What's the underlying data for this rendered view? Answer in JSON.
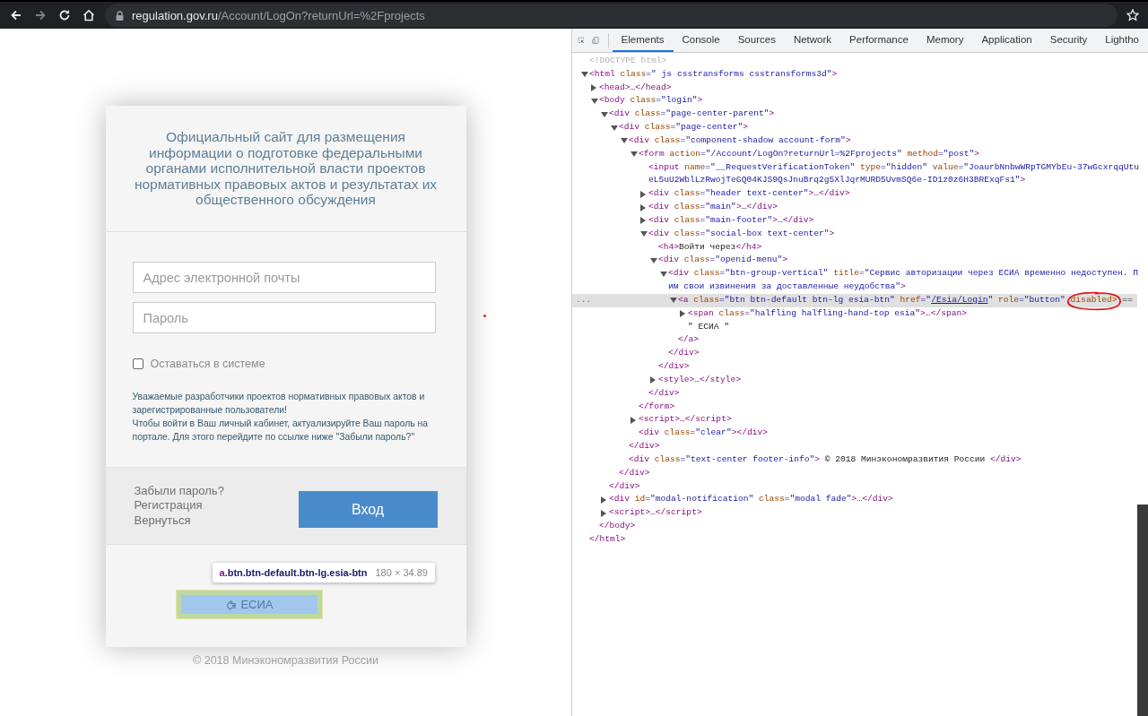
{
  "browser": {
    "nav": [
      {
        "kind": "back",
        "disabled": false
      },
      {
        "kind": "forward",
        "disabled": true
      },
      {
        "kind": "reload",
        "disabled": false
      },
      {
        "kind": "home",
        "disabled": false
      }
    ],
    "address": {
      "host": "regulation.gov.ru",
      "path": "/Account/LogOn?returnUrl=%2Fprojects"
    }
  },
  "login": {
    "title": "Официальный сайт для размещения информации о подготовке федеральными органами исполнительной власти проектов нормативных правовых актов и результатах их общественного обсуждения",
    "email": {
      "placeholder": "Адрес электронной почты"
    },
    "password": {
      "placeholder": "Пароль"
    },
    "remember": {
      "label": "Оставаться в системе",
      "checked": false
    },
    "notice": [
      "Уважаемые разработчики проектов нормативных правовых актов и зарегистрированные пользователи!",
      "Чтобы войти в Ваш личный кабинет, актуализируйте Ваш пароль на портале. Для этого перейдите по ссылке ниже \"Забыли пароль?\""
    ],
    "links": [
      "Забыли пароль?",
      "Регистрация",
      "Вернуться"
    ],
    "submit": "Вход",
    "esia": {
      "label": "ЕСИА",
      "disabled": true,
      "highlighted": true
    },
    "tooltip": {
      "tag": "a",
      "selector": ".btn.btn-default.btn-lg.esia-btn",
      "size": "180 × 34.89"
    }
  },
  "footer": "© 2018 Минэкономразвития России",
  "devtools": {
    "tabs": [
      {
        "label": "Elements",
        "selected": true
      },
      {
        "label": "Console",
        "selected": false
      },
      {
        "label": "Sources",
        "selected": false
      },
      {
        "label": "Network",
        "selected": false
      },
      {
        "label": "Performance",
        "selected": false
      },
      {
        "label": "Memory",
        "selected": false
      },
      {
        "label": "Application",
        "selected": false
      },
      {
        "label": "Security",
        "selected": false
      },
      {
        "label": "Lightho",
        "selected": false
      }
    ],
    "dom": [
      {
        "kind": "leaf",
        "selected": false,
        "lines": [
          [
            {
              "kind": "doc",
              "text": "<!DOCTYPE html>"
            }
          ]
        ]
      },
      {
        "kind": "node",
        "expanded": true,
        "selected": false,
        "lines": [
          [
            {
              "kind": "tag",
              "text": "<html"
            },
            {
              "kind": "attr",
              "text": " class"
            },
            {
              "kind": "val",
              "text": "=\" js csstransforms csstransforms3d\""
            },
            {
              "kind": "tag",
              "text": ">"
            }
          ]
        ],
        "close": [
          {
            "kind": "tag",
            "text": "</html>"
          }
        ],
        "children": [
          {
            "kind": "node",
            "expanded": false,
            "selected": false,
            "lines": [
              [
                {
                  "kind": "tag",
                  "text": "<head>"
                },
                {
                  "kind": "plain",
                  "text": "…"
                },
                {
                  "kind": "tag",
                  "text": "</head>"
                }
              ]
            ]
          },
          {
            "kind": "node",
            "expanded": true,
            "selected": false,
            "lines": [
              [
                {
                  "kind": "tag",
                  "text": "<body"
                },
                {
                  "kind": "attr",
                  "text": " class"
                },
                {
                  "kind": "val",
                  "text": "=\"login\""
                },
                {
                  "kind": "tag",
                  "text": ">"
                }
              ]
            ],
            "close": [
              {
                "kind": "tag",
                "text": "</body>"
              }
            ],
            "children": [
              {
                "kind": "node",
                "expanded": true,
                "selected": false,
                "lines": [
                  [
                    {
                      "kind": "tag",
                      "text": "<div"
                    },
                    {
                      "kind": "attr",
                      "text": " class"
                    },
                    {
                      "kind": "val",
                      "text": "=\"page-center-parent\""
                    },
                    {
                      "kind": "tag",
                      "text": ">"
                    }
                  ]
                ],
                "close": [
                  {
                    "kind": "tag",
                    "text": "</div>"
                  }
                ],
                "children": [
                  {
                    "kind": "node",
                    "expanded": true,
                    "selected": false,
                    "lines": [
                      [
                        {
                          "kind": "tag",
                          "text": "<div"
                        },
                        {
                          "kind": "attr",
                          "text": " class"
                        },
                        {
                          "kind": "val",
                          "text": "=\"page-center\""
                        },
                        {
                          "kind": "tag",
                          "text": ">"
                        }
                      ]
                    ],
                    "close": [
                      {
                        "kind": "tag",
                        "text": "</div>"
                      }
                    ],
                    "children": [
                      {
                        "kind": "node",
                        "expanded": true,
                        "selected": false,
                        "lines": [
                          [
                            {
                              "kind": "tag",
                              "text": "<div"
                            },
                            {
                              "kind": "attr",
                              "text": " class"
                            },
                            {
                              "kind": "val",
                              "text": "=\"component-shadow account-form\""
                            },
                            {
                              "kind": "tag",
                              "text": ">"
                            }
                          ]
                        ],
                        "close": [
                          {
                            "kind": "tag",
                            "text": "</div>"
                          }
                        ],
                        "children": [
                          {
                            "kind": "node",
                            "expanded": true,
                            "selected": false,
                            "lines": [
                              [
                                {
                                  "kind": "tag",
                                  "text": "<form"
                                },
                                {
                                  "kind": "attr",
                                  "text": " action"
                                },
                                {
                                  "kind": "val",
                                  "text": "=\"/Account/LogOn?returnUrl=%2Fprojects\""
                                },
                                {
                                  "kind": "attr",
                                  "text": " method"
                                },
                                {
                                  "kind": "val",
                                  "text": "=\"post\""
                                },
                                {
                                  "kind": "tag",
                                  "text": ">"
                                }
                              ]
                            ],
                            "close": [
                              {
                                "kind": "tag",
                                "text": "</form>"
                              }
                            ],
                            "children": [
                              {
                                "kind": "leaf",
                                "selected": false,
                                "lines": [
                                  [
                                    {
                                      "kind": "tag",
                                      "text": "<input"
                                    },
                                    {
                                      "kind": "attr",
                                      "text": " name"
                                    },
                                    {
                                      "kind": "val",
                                      "text": "=\"__RequestVerificationToken\""
                                    },
                                    {
                                      "kind": "attr",
                                      "text": " type"
                                    },
                                    {
                                      "kind": "val",
                                      "text": "=\"hidden\""
                                    },
                                    {
                                      "kind": "attr",
                                      "text": " value"
                                    },
                                    {
                                      "kind": "val",
                                      "text": "=\"JoaurbNnbwWRpTGMYbEu-37wGcxrqqUtu"
                                    }
                                  ],
                                  [
                                    {
                                      "kind": "val",
                                      "text": "eL5uU2WblLzRwojTeGQ04KJS9QsJnuBrq2g5XlJqrMURD5UvmSQ6e-ID1z0z6H3BRExqFs1\""
                                    },
                                    {
                                      "kind": "tag",
                                      "text": ">"
                                    }
                                  ]
                                ]
                              },
                              {
                                "kind": "node",
                                "expanded": false,
                                "selected": false,
                                "lines": [
                                  [
                                    {
                                      "kind": "tag",
                                      "text": "<div"
                                    },
                                    {
                                      "kind": "attr",
                                      "text": " class"
                                    },
                                    {
                                      "kind": "val",
                                      "text": "=\"header text-center\""
                                    },
                                    {
                                      "kind": "tag",
                                      "text": ">"
                                    },
                                    {
                                      "kind": "plain",
                                      "text": "…"
                                    },
                                    {
                                      "kind": "tag",
                                      "text": "</div>"
                                    }
                                  ]
                                ]
                              },
                              {
                                "kind": "node",
                                "expanded": false,
                                "selected": false,
                                "lines": [
                                  [
                                    {
                                      "kind": "tag",
                                      "text": "<div"
                                    },
                                    {
                                      "kind": "attr",
                                      "text": " class"
                                    },
                                    {
                                      "kind": "val",
                                      "text": "=\"main\""
                                    },
                                    {
                                      "kind": "tag",
                                      "text": ">"
                                    },
                                    {
                                      "kind": "plain",
                                      "text": "…"
                                    },
                                    {
                                      "kind": "tag",
                                      "text": "</div>"
                                    }
                                  ]
                                ]
                              },
                              {
                                "kind": "node",
                                "expanded": false,
                                "selected": false,
                                "lines": [
                                  [
                                    {
                                      "kind": "tag",
                                      "text": "<div"
                                    },
                                    {
                                      "kind": "attr",
                                      "text": " class"
                                    },
                                    {
                                      "kind": "val",
                                      "text": "=\"main-footer\""
                                    },
                                    {
                                      "kind": "tag",
                                      "text": ">"
                                    },
                                    {
                                      "kind": "plain",
                                      "text": "…"
                                    },
                                    {
                                      "kind": "tag",
                                      "text": "</div>"
                                    }
                                  ]
                                ]
                              },
                              {
                                "kind": "node",
                                "expanded": true,
                                "selected": false,
                                "lines": [
                                  [
                                    {
                                      "kind": "tag",
                                      "text": "<div"
                                    },
                                    {
                                      "kind": "attr",
                                      "text": " class"
                                    },
                                    {
                                      "kind": "val",
                                      "text": "=\"social-box text-center\""
                                    },
                                    {
                                      "kind": "tag",
                                      "text": ">"
                                    }
                                  ]
                                ],
                                "close": [
                                  {
                                    "kind": "tag",
                                    "text": "</div>"
                                  }
                                ],
                                "children": [
                                  {
                                    "kind": "leaf",
                                    "selected": false,
                                    "lines": [
                                      [
                                        {
                                          "kind": "tag",
                                          "text": "<h4>"
                                        },
                                        {
                                          "kind": "plain",
                                          "text": "Войти через"
                                        },
                                        {
                                          "kind": "tag",
                                          "text": "</h4>"
                                        }
                                      ]
                                    ]
                                  },
                                  {
                                    "kind": "node",
                                    "expanded": true,
                                    "selected": false,
                                    "lines": [
                                      [
                                        {
                                          "kind": "tag",
                                          "text": "<div"
                                        },
                                        {
                                          "kind": "attr",
                                          "text": " class"
                                        },
                                        {
                                          "kind": "val",
                                          "text": "=\"openid-menu\""
                                        },
                                        {
                                          "kind": "tag",
                                          "text": ">"
                                        }
                                      ]
                                    ],
                                    "close": [
                                      {
                                        "kind": "tag",
                                        "text": "</div>"
                                      }
                                    ],
                                    "children": [
                                      {
                                        "kind": "node",
                                        "expanded": true,
                                        "selected": false,
                                        "lines": [
                                          [
                                            {
                                              "kind": "tag",
                                              "text": "<div"
                                            },
                                            {
                                              "kind": "attr",
                                              "text": " class"
                                            },
                                            {
                                              "kind": "val",
                                              "text": "=\"btn-group-vertical\""
                                            },
                                            {
                                              "kind": "attr",
                                              "text": " title"
                                            },
                                            {
                                              "kind": "val",
                                              "text": "=\"Сервис авторизации через ЕСИА временно недоступен. П"
                                            }
                                          ],
                                          [
                                            {
                                              "kind": "val",
                                              "text": "им свои извинения за доставленные неудобства\""
                                            },
                                            {
                                              "kind": "tag",
                                              "text": ">"
                                            }
                                          ]
                                        ],
                                        "close": [
                                          {
                                            "kind": "tag",
                                            "text": "</div>"
                                          }
                                        ],
                                        "children": [
                                          {
                                            "kind": "node",
                                            "expanded": true,
                                            "selected": true,
                                            "gutter_marker": "...",
                                            "lines": [
                                              [
                                                {
                                                  "kind": "tag",
                                                  "text": "<a"
                                                },
                                                {
                                                  "kind": "attr",
                                                  "text": " class"
                                                },
                                                {
                                                  "kind": "val",
                                                  "text": "=\"btn btn-default btn-lg esia-btn\""
                                                },
                                                {
                                                  "kind": "attr",
                                                  "text": " href"
                                                },
                                                {
                                                  "kind": "val",
                                                  "text": "=\""
                                                },
                                                {
                                                  "kind": "link",
                                                  "text": "/Esia/Login"
                                                },
                                                {
                                                  "kind": "val",
                                                  "text": "\""
                                                },
                                                {
                                                  "kind": "attr",
                                                  "text": " role"
                                                },
                                                {
                                                  "kind": "val",
                                                  "text": "=\"button\" "
                                                },
                                                {
                                                  "kind": "circled",
                                                  "text": "disabled>"
                                                },
                                                {
                                                  "kind": "plain",
                                                  "text": " =="
                                                }
                                              ]
                                            ],
                                            "close": [
                                              {
                                                "kind": "tag",
                                                "text": "</a>"
                                              }
                                            ],
                                            "children": [
                                              {
                                                "kind": "node",
                                                "expanded": false,
                                                "selected": false,
                                                "lines": [
                                                  [
                                                    {
                                                      "kind": "tag",
                                                      "text": "<span"
                                                    },
                                                    {
                                                      "kind": "attr",
                                                      "text": " class"
                                                    },
                                                    {
                                                      "kind": "val",
                                                      "text": "=\"halfling halfling-hand-top esia\""
                                                    },
                                                    {
                                                      "kind": "tag",
                                                      "text": ">"
                                                    },
                                                    {
                                                      "kind": "plain",
                                                      "text": "…"
                                                    },
                                                    {
                                                      "kind": "tag",
                                                      "text": "</span>"
                                                    }
                                                  ]
                                                ]
                                              },
                                              {
                                                "kind": "leaf",
                                                "selected": false,
                                                "lines": [
                                                  [
                                                    {
                                                      "kind": "plain",
                                                      "text": "\" ЕСИА \""
                                                    }
                                                  ]
                                                ]
                                              }
                                            ]
                                          }
                                        ]
                                      }
                                    ]
                                  },
                                  {
                                    "kind": "node",
                                    "expanded": false,
                                    "selected": false,
                                    "lines": [
                                      [
                                        {
                                          "kind": "tag",
                                          "text": "<style>"
                                        },
                                        {
                                          "kind": "plain",
                                          "text": "…"
                                        },
                                        {
                                          "kind": "tag",
                                          "text": "</style>"
                                        }
                                      ]
                                    ]
                                  }
                                ]
                              }
                            ]
                          },
                          {
                            "kind": "node",
                            "expanded": false,
                            "selected": false,
                            "lines": [
                              [
                                {
                                  "kind": "tag",
                                  "text": "<script>"
                                },
                                {
                                  "kind": "plain",
                                  "text": "…"
                                },
                                {
                                  "kind": "tag",
                                  "text": "</script>"
                                }
                              ]
                            ]
                          },
                          {
                            "kind": "leaf",
                            "selected": false,
                            "lines": [
                              [
                                {
                                  "kind": "tag",
                                  "text": "<div"
                                },
                                {
                                  "kind": "attr",
                                  "text": " class"
                                },
                                {
                                  "kind": "val",
                                  "text": "=\"clear\""
                                },
                                {
                                  "kind": "tag",
                                  "text": ">"
                                },
                                {
                                  "kind": "tag",
                                  "text": "</div>"
                                }
                              ]
                            ]
                          }
                        ]
                      },
                      {
                        "kind": "leaf",
                        "selected": false,
                        "lines": [
                          [
                            {
                              "kind": "tag",
                              "text": "<div"
                            },
                            {
                              "kind": "attr",
                              "text": " class"
                            },
                            {
                              "kind": "val",
                              "text": "=\"text-center footer-info\""
                            },
                            {
                              "kind": "tag",
                              "text": ">"
                            },
                            {
                              "kind": "plain",
                              "text": " © 2018 Минэкономразвития России "
                            },
                            {
                              "kind": "tag",
                              "text": "</div>"
                            }
                          ]
                        ]
                      }
                    ]
                  }
                ]
              },
              {
                "kind": "node",
                "expanded": false,
                "selected": false,
                "lines": [
                  [
                    {
                      "kind": "tag",
                      "text": "<div"
                    },
                    {
                      "kind": "attr",
                      "text": " id"
                    },
                    {
                      "kind": "val",
                      "text": "=\"modal-notification\""
                    },
                    {
                      "kind": "attr",
                      "text": " class"
                    },
                    {
                      "kind": "val",
                      "text": "=\"modal fade\""
                    },
                    {
                      "kind": "tag",
                      "text": ">"
                    },
                    {
                      "kind": "plain",
                      "text": "…"
                    },
                    {
                      "kind": "tag",
                      "text": "</div>"
                    }
                  ]
                ]
              },
              {
                "kind": "node",
                "expanded": false,
                "selected": false,
                "lines": [
                  [
                    {
                      "kind": "tag",
                      "text": "<script>"
                    },
                    {
                      "kind": "plain",
                      "text": "…"
                    },
                    {
                      "kind": "tag",
                      "text": "</script>"
                    }
                  ]
                ]
              }
            ]
          }
        ]
      }
    ]
  }
}
